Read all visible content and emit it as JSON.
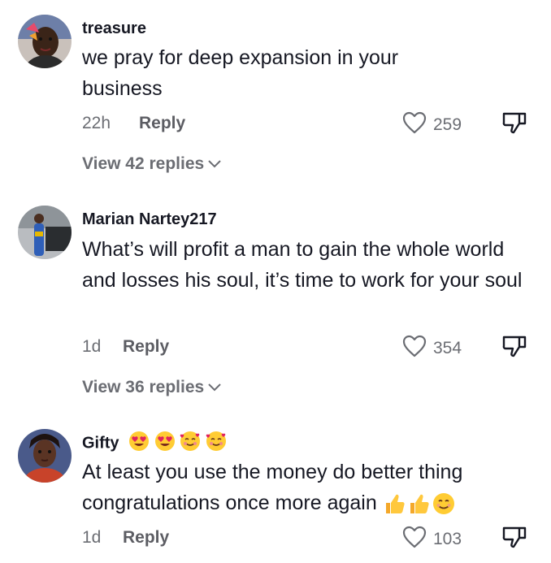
{
  "comments": [
    {
      "username": "treasure",
      "text": "we pray for deep expansion in your business",
      "time": "22h",
      "reply_label": "Reply",
      "likes": "259",
      "view_replies": "View 42 replies",
      "avatar_icon": "profile-photo-woman"
    },
    {
      "username": "Marian Nartey217",
      "text": "What’s will profit a man to gain the whole world and losses his soul, it’s time to work for your soul",
      "time": "1d",
      "reply_label": "Reply",
      "likes": "354",
      "view_replies": "View 36 replies",
      "avatar_icon": "profile-photo-person-standing"
    },
    {
      "username": "Gifty",
      "username_emojis": [
        "heart-eyes-emoji",
        "heart-eyes-emoji",
        "smiling-face-with-hearts-emoji",
        "smiling-face-with-hearts-emoji"
      ],
      "text": "At least you use the money do better thing congratulations once more again",
      "text_emojis": [
        "thumbs-up-emoji",
        "thumbs-up-emoji",
        "smiling-face-emoji"
      ],
      "time": "1d",
      "reply_label": "Reply",
      "likes": "103",
      "avatar_icon": "profile-photo-woman-portrait"
    }
  ],
  "colors": {
    "text": "#161823",
    "secondary": "#6b6d73",
    "background": "#ffffff"
  }
}
